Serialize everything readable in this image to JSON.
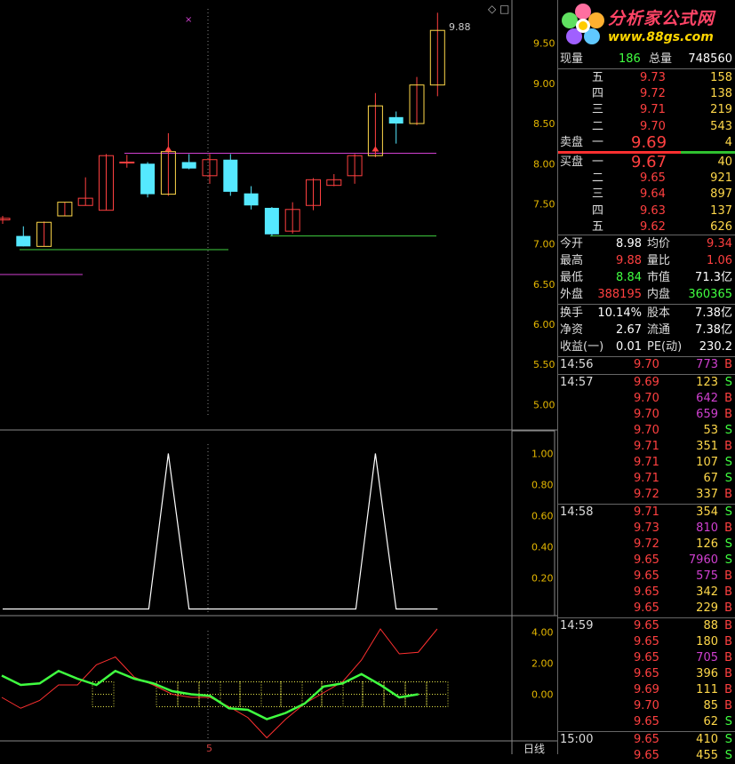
{
  "chart_data": [
    {
      "type": "candlestick",
      "title": "",
      "y_ticks": [
        "9.50",
        "9.00",
        "8.50",
        "8.00",
        "7.50",
        "7.00",
        "6.50",
        "6.00",
        "5.50",
        "5.00"
      ],
      "y_tick_values": [
        9.5,
        9.0,
        8.5,
        8.0,
        7.5,
        7.0,
        6.5,
        6.0,
        5.5,
        5.0
      ],
      "ylim": [
        4.75,
        9.95
      ],
      "max_label": "9.88",
      "candles": [
        {
          "o": 7.3,
          "h": 7.35,
          "l": 7.25,
          "c": 7.32
        },
        {
          "o": 7.1,
          "h": 7.22,
          "l": 6.97,
          "c": 6.97
        },
        {
          "o": 6.97,
          "h": 7.28,
          "l": 6.97,
          "c": 7.27
        },
        {
          "o": 7.35,
          "h": 7.52,
          "l": 7.35,
          "c": 7.52
        },
        {
          "o": 7.48,
          "h": 7.83,
          "l": 7.48,
          "c": 7.57
        },
        {
          "o": 7.42,
          "h": 8.12,
          "l": 7.42,
          "c": 8.1
        },
        {
          "o": 8.02,
          "h": 8.11,
          "l": 7.95,
          "c": 8.02
        },
        {
          "o": 8.0,
          "h": 8.02,
          "l": 7.58,
          "c": 7.62
        },
        {
          "o": 7.62,
          "h": 8.38,
          "l": 7.6,
          "c": 8.15
        },
        {
          "o": 8.02,
          "h": 8.12,
          "l": 7.93,
          "c": 7.94
        },
        {
          "o": 7.85,
          "h": 8.12,
          "l": 7.75,
          "c": 8.05
        },
        {
          "o": 8.05,
          "h": 8.12,
          "l": 7.6,
          "c": 7.65
        },
        {
          "o": 7.63,
          "h": 7.72,
          "l": 7.43,
          "c": 7.48
        },
        {
          "o": 7.45,
          "h": 7.46,
          "l": 7.1,
          "c": 7.12
        },
        {
          "o": 7.16,
          "h": 7.52,
          "l": 7.13,
          "c": 7.43
        },
        {
          "o": 7.48,
          "h": 7.82,
          "l": 7.42,
          "c": 7.8
        },
        {
          "o": 7.73,
          "h": 7.87,
          "l": 7.72,
          "c": 7.8
        },
        {
          "o": 7.85,
          "h": 8.12,
          "l": 7.75,
          "c": 8.1
        },
        {
          "o": 8.1,
          "h": 8.88,
          "l": 8.08,
          "c": 8.72
        },
        {
          "o": 8.58,
          "h": 8.65,
          "l": 8.25,
          "c": 8.5
        },
        {
          "o": 8.5,
          "h": 9.08,
          "l": 8.48,
          "c": 8.98
        },
        {
          "o": 8.98,
          "h": 9.88,
          "l": 8.84,
          "c": 9.66
        }
      ],
      "resistance_value": 8.13,
      "support_values": [
        6.93,
        7.1
      ],
      "purple_line_value": 6.62
    },
    {
      "type": "line",
      "y_ticks": [
        "1.00",
        "0.80",
        "0.60",
        "0.40",
        "0.20"
      ],
      "y_tick_values": [
        1.0,
        0.8,
        0.6,
        0.4,
        0.2
      ],
      "ylim": [
        -0.02,
        1.1
      ],
      "values": [
        0,
        0,
        0,
        0,
        0,
        0,
        0,
        0,
        1,
        0,
        0,
        0,
        0,
        0,
        0,
        0,
        0,
        0,
        1,
        0,
        0,
        0
      ]
    },
    {
      "type": "line",
      "y_ticks": [
        "4.00",
        "2.00",
        "0.00"
      ],
      "y_tick_values": [
        4.0,
        2.0,
        0.0
      ],
      "ylim": [
        -3.0,
        5.0
      ],
      "series": [
        {
          "values": [
            -0.2,
            -0.9,
            -0.4,
            0.6,
            0.6,
            1.9,
            2.4,
            1.1,
            0.6,
            0.0,
            -0.2,
            -0.2,
            -0.8,
            -1.5,
            -2.8,
            -1.6,
            -0.6,
            0.1,
            0.8,
            2.2,
            4.2,
            2.6,
            2.7,
            4.2
          ]
        },
        {
          "values": [
            1.2,
            0.6,
            0.7,
            1.5,
            1.0,
            0.6,
            1.5,
            1.0,
            0.7,
            0.2,
            0.0,
            -0.1,
            -0.9,
            -1.0,
            -1.6,
            -1.2,
            -0.6,
            0.5,
            0.7,
            1.3,
            0.6,
            -0.2,
            0.0
          ]
        }
      ]
    }
  ],
  "chart": {
    "x_marker": "5",
    "period_label": "日线",
    "diamond_icon": "◇",
    "square_icon": "□"
  },
  "logo": {
    "name": "分析家公式网",
    "url": "www.88gs.com"
  },
  "quote": {
    "xianliang_label": "现量",
    "xianliang_value": "186",
    "zongliang_label": "总量",
    "zongliang_value": "748560",
    "sell_label": "卖盘",
    "buy_label": "买盘",
    "sells": [
      {
        "level": "五",
        "price": "9.73",
        "vol": "158"
      },
      {
        "level": "四",
        "price": "9.72",
        "vol": "138"
      },
      {
        "level": "三",
        "price": "9.71",
        "vol": "219"
      },
      {
        "level": "二",
        "price": "9.70",
        "vol": "543"
      },
      {
        "level": "一",
        "price": "9.69",
        "vol": "4"
      }
    ],
    "buys": [
      {
        "level": "一",
        "price": "9.67",
        "vol": "40"
      },
      {
        "level": "二",
        "price": "9.65",
        "vol": "921"
      },
      {
        "level": "三",
        "price": "9.64",
        "vol": "897"
      },
      {
        "level": "四",
        "price": "9.63",
        "vol": "137"
      },
      {
        "level": "五",
        "price": "9.62",
        "vol": "626"
      }
    ],
    "stats": [
      {
        "l1": "今开",
        "v1": "8.98",
        "c1": "white",
        "l2": "均价",
        "v2": "9.34",
        "c2": "red"
      },
      {
        "l1": "最高",
        "v1": "9.88",
        "c1": "red",
        "l2": "量比",
        "v2": "1.06",
        "c2": "red"
      },
      {
        "l1": "最低",
        "v1": "8.84",
        "c1": "green",
        "l2": "市值",
        "v2": "71.3亿",
        "c2": "white"
      },
      {
        "l1": "外盘",
        "v1": "388195",
        "c1": "red",
        "l2": "内盘",
        "v2": "360365",
        "c2": "green"
      }
    ],
    "stats2": [
      {
        "l1": "换手",
        "v1": "10.14%",
        "l2": "股本",
        "v2": "7.38亿"
      },
      {
        "l1": "净资",
        "v1": "2.67",
        "l2": "流通",
        "v2": "7.38亿"
      },
      {
        "l1": "收益(一)",
        "v1": "0.01",
        "l2": "PE(动)",
        "v2": "230.2"
      }
    ]
  },
  "ticks": [
    {
      "time": "14:56",
      "price": "9.70",
      "vol": "773",
      "side": "B",
      "vcolor": "purple"
    },
    {
      "time": "14:57",
      "price": "9.69",
      "vol": "123",
      "side": "S",
      "vcolor": "yellow"
    },
    {
      "time": "",
      "price": "9.70",
      "vol": "642",
      "side": "B",
      "vcolor": "purple"
    },
    {
      "time": "",
      "price": "9.70",
      "vol": "659",
      "side": "B",
      "vcolor": "purple"
    },
    {
      "time": "",
      "price": "9.70",
      "vol": "53",
      "side": "S",
      "vcolor": "yellow"
    },
    {
      "time": "",
      "price": "9.71",
      "vol": "351",
      "side": "B",
      "vcolor": "yellow"
    },
    {
      "time": "",
      "price": "9.71",
      "vol": "107",
      "side": "S",
      "vcolor": "yellow"
    },
    {
      "time": "",
      "price": "9.71",
      "vol": "67",
      "side": "S",
      "vcolor": "yellow"
    },
    {
      "time": "",
      "price": "9.72",
      "vol": "337",
      "side": "B",
      "vcolor": "yellow"
    },
    {
      "time": "14:58",
      "price": "9.71",
      "vol": "354",
      "side": "S",
      "vcolor": "yellow"
    },
    {
      "time": "",
      "price": "9.73",
      "vol": "810",
      "side": "B",
      "vcolor": "purple"
    },
    {
      "time": "",
      "price": "9.72",
      "vol": "126",
      "side": "S",
      "vcolor": "yellow"
    },
    {
      "time": "",
      "price": "9.65",
      "vol": "7960",
      "side": "S",
      "vcolor": "purple"
    },
    {
      "time": "",
      "price": "9.65",
      "vol": "575",
      "side": "B",
      "vcolor": "purple"
    },
    {
      "time": "",
      "price": "9.65",
      "vol": "342",
      "side": "B",
      "vcolor": "yellow"
    },
    {
      "time": "",
      "price": "9.65",
      "vol": "229",
      "side": "B",
      "vcolor": "yellow"
    },
    {
      "time": "14:59",
      "price": "9.65",
      "vol": "88",
      "side": "B",
      "vcolor": "yellow"
    },
    {
      "time": "",
      "price": "9.65",
      "vol": "180",
      "side": "B",
      "vcolor": "yellow"
    },
    {
      "time": "",
      "price": "9.65",
      "vol": "705",
      "side": "B",
      "vcolor": "purple"
    },
    {
      "time": "",
      "price": "9.65",
      "vol": "396",
      "side": "B",
      "vcolor": "yellow"
    },
    {
      "time": "",
      "price": "9.69",
      "vol": "111",
      "side": "B",
      "vcolor": "yellow"
    },
    {
      "time": "",
      "price": "9.70",
      "vol": "85",
      "side": "B",
      "vcolor": "yellow"
    },
    {
      "time": "",
      "price": "9.65",
      "vol": "62",
      "side": "S",
      "vcolor": "yellow"
    },
    {
      "time": "15:00",
      "price": "9.65",
      "vol": "410",
      "side": "S",
      "vcolor": "yellow"
    },
    {
      "time": "",
      "price": "9.65",
      "vol": "455",
      "side": "S",
      "vcolor": "yellow"
    }
  ]
}
